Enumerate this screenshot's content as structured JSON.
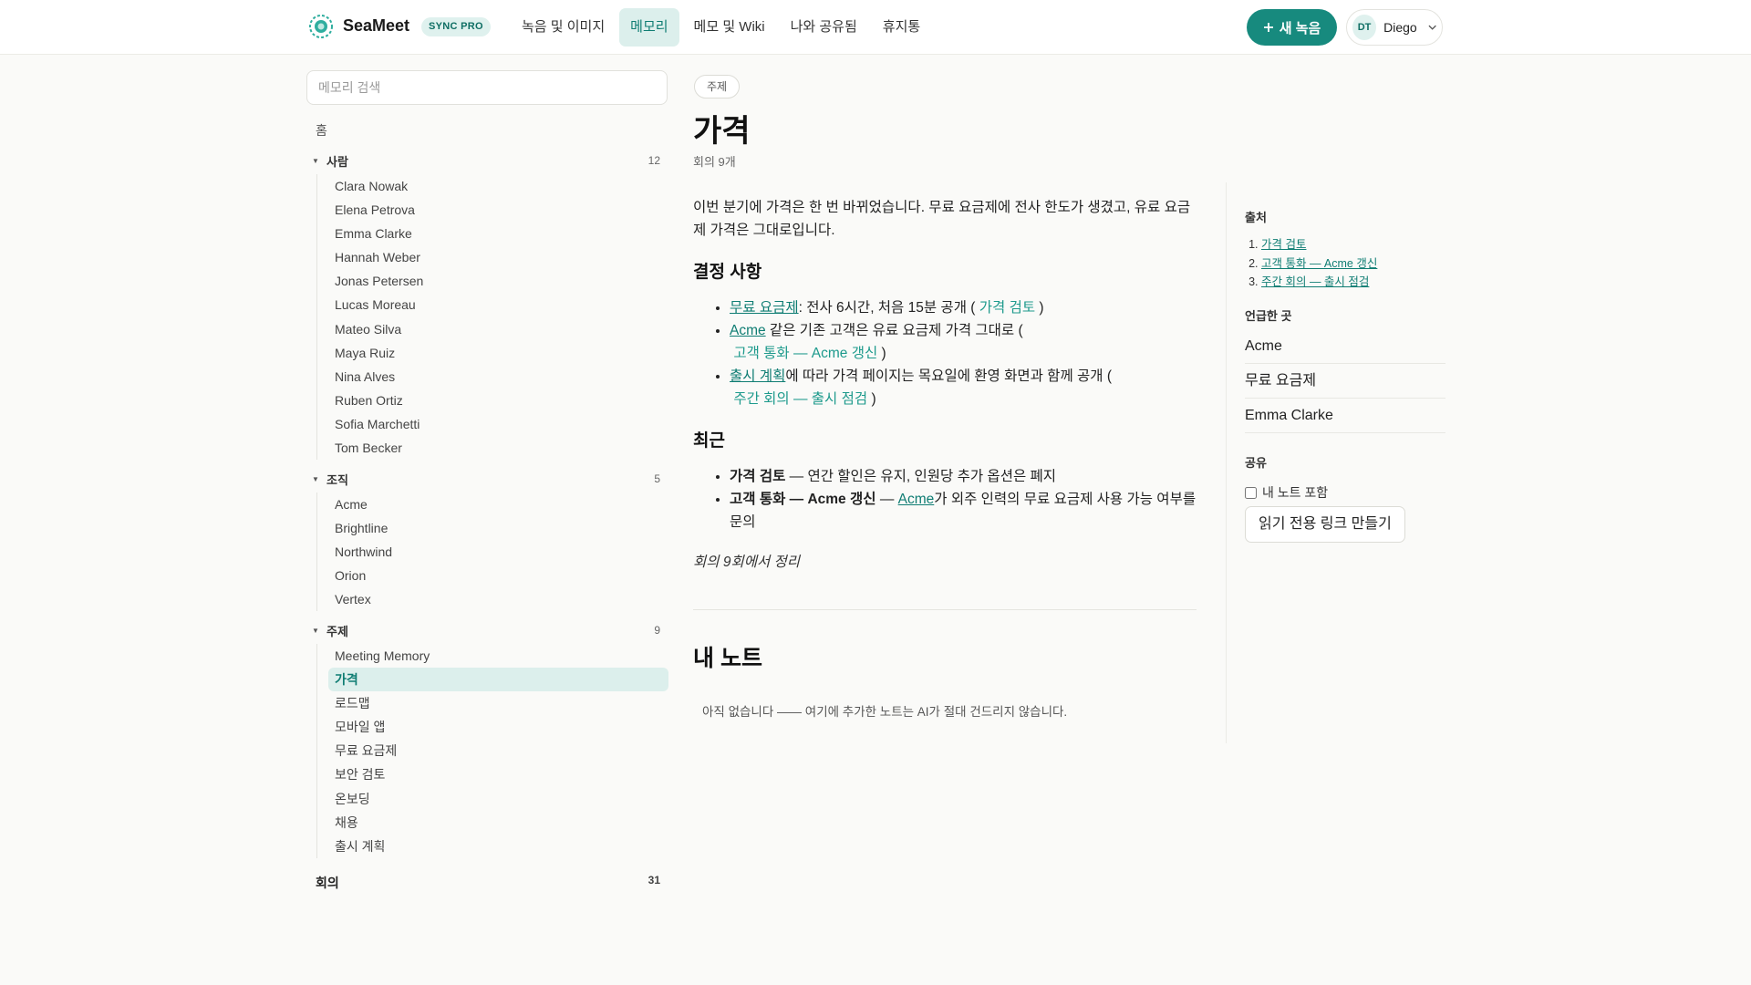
{
  "header": {
    "brand": "SeaMeet",
    "plan_badge": "SYNC PRO",
    "nav": [
      "녹음 및 이미지",
      "메모리",
      "메모 및 Wiki",
      "나와 공유됨",
      "휴지통"
    ],
    "active_nav": "메모리",
    "new_recording_label": "새 녹음",
    "user_initials": "DT",
    "user_name": "Diego",
    "accent_color": "#178a7e"
  },
  "sidebar": {
    "search_placeholder": "메모리 검색",
    "home_label": "홈",
    "groups": [
      {
        "label": "사람",
        "count": "12",
        "items": [
          "Clara Nowak",
          "Elena Petrova",
          "Emma Clarke",
          "Hannah Weber",
          "Jonas Petersen",
          "Lucas Moreau",
          "Mateo Silva",
          "Maya Ruiz",
          "Nina Alves",
          "Ruben Ortiz",
          "Sofia Marchetti",
          "Tom Becker"
        ]
      },
      {
        "label": "조직",
        "count": "5",
        "items": [
          "Acme",
          "Brightline",
          "Northwind",
          "Orion",
          "Vertex"
        ]
      },
      {
        "label": "주제",
        "count": "9",
        "items": [
          "Meeting Memory",
          "가격",
          "로드맵",
          "모바일 앱",
          "무료 요금제",
          "보안 검토",
          "온보딩",
          "채용",
          "출시 계획"
        ]
      }
    ],
    "active_item": "가격",
    "meetings_label": "회의",
    "meetings_count": "31"
  },
  "main": {
    "chip": "주제",
    "title": "가격",
    "meta": "회의 9개",
    "intro": "이번 분기에 가격은 한 번 바뀌었습니다. 무료 요금제에 전사 한도가 생겼고, 유료 요금제 가격은 그대로입니다.",
    "decisions_heading": "결정 사항",
    "decisions": [
      {
        "link": "무료 요금제",
        "text": ": 전사 6시간, 처음 15분 공개 (",
        "source": "가격 검토",
        "end": ")"
      },
      {
        "link": "Acme",
        "text": " 같은 기존 고객은 유료 요금제 가격 그대로 (",
        "source": "고객 통화 — Acme 갱신",
        "end": ")"
      },
      {
        "link": "출시 계획",
        "text": "에 따라 가격 페이지는 목요일에 환영 화면과 함께 공개 (",
        "source": "주간 회의 — 출시 점검",
        "end": ")"
      }
    ],
    "recent_heading": "최근",
    "recent": [
      {
        "title": "가격 검토",
        "pre": " — 연간 할인은 유지, 인원당 추가 옵션은 폐지",
        "link": "",
        "post": ""
      },
      {
        "title": "고객 통화 — Acme 갱신",
        "pre": " — ",
        "link": "Acme",
        "post": "가 외주 인력의 무료 요금제 사용 가능 여부를 문의"
      }
    ],
    "summary": "회의 9회에서 정리",
    "my_notes_heading": "내 노트",
    "my_notes_empty": "아직 없습니다 —— 여기에 추가한 노트는 AI가 절대 건드리지 않습니다."
  },
  "rail": {
    "sources_heading": "출처",
    "sources": [
      "가격 검토",
      "고객 통화 — Acme 갱신",
      "주간 회의 — 출시 점검"
    ],
    "mentioned_heading": "언급한 곳",
    "mentioned": [
      "Acme",
      "무료 요금제",
      "Emma Clarke"
    ],
    "share_heading": "공유",
    "include_notes_label": "내 노트 포함",
    "include_notes_checked": false,
    "readonly_link_button": "읽기 전용 링크 만들기"
  }
}
